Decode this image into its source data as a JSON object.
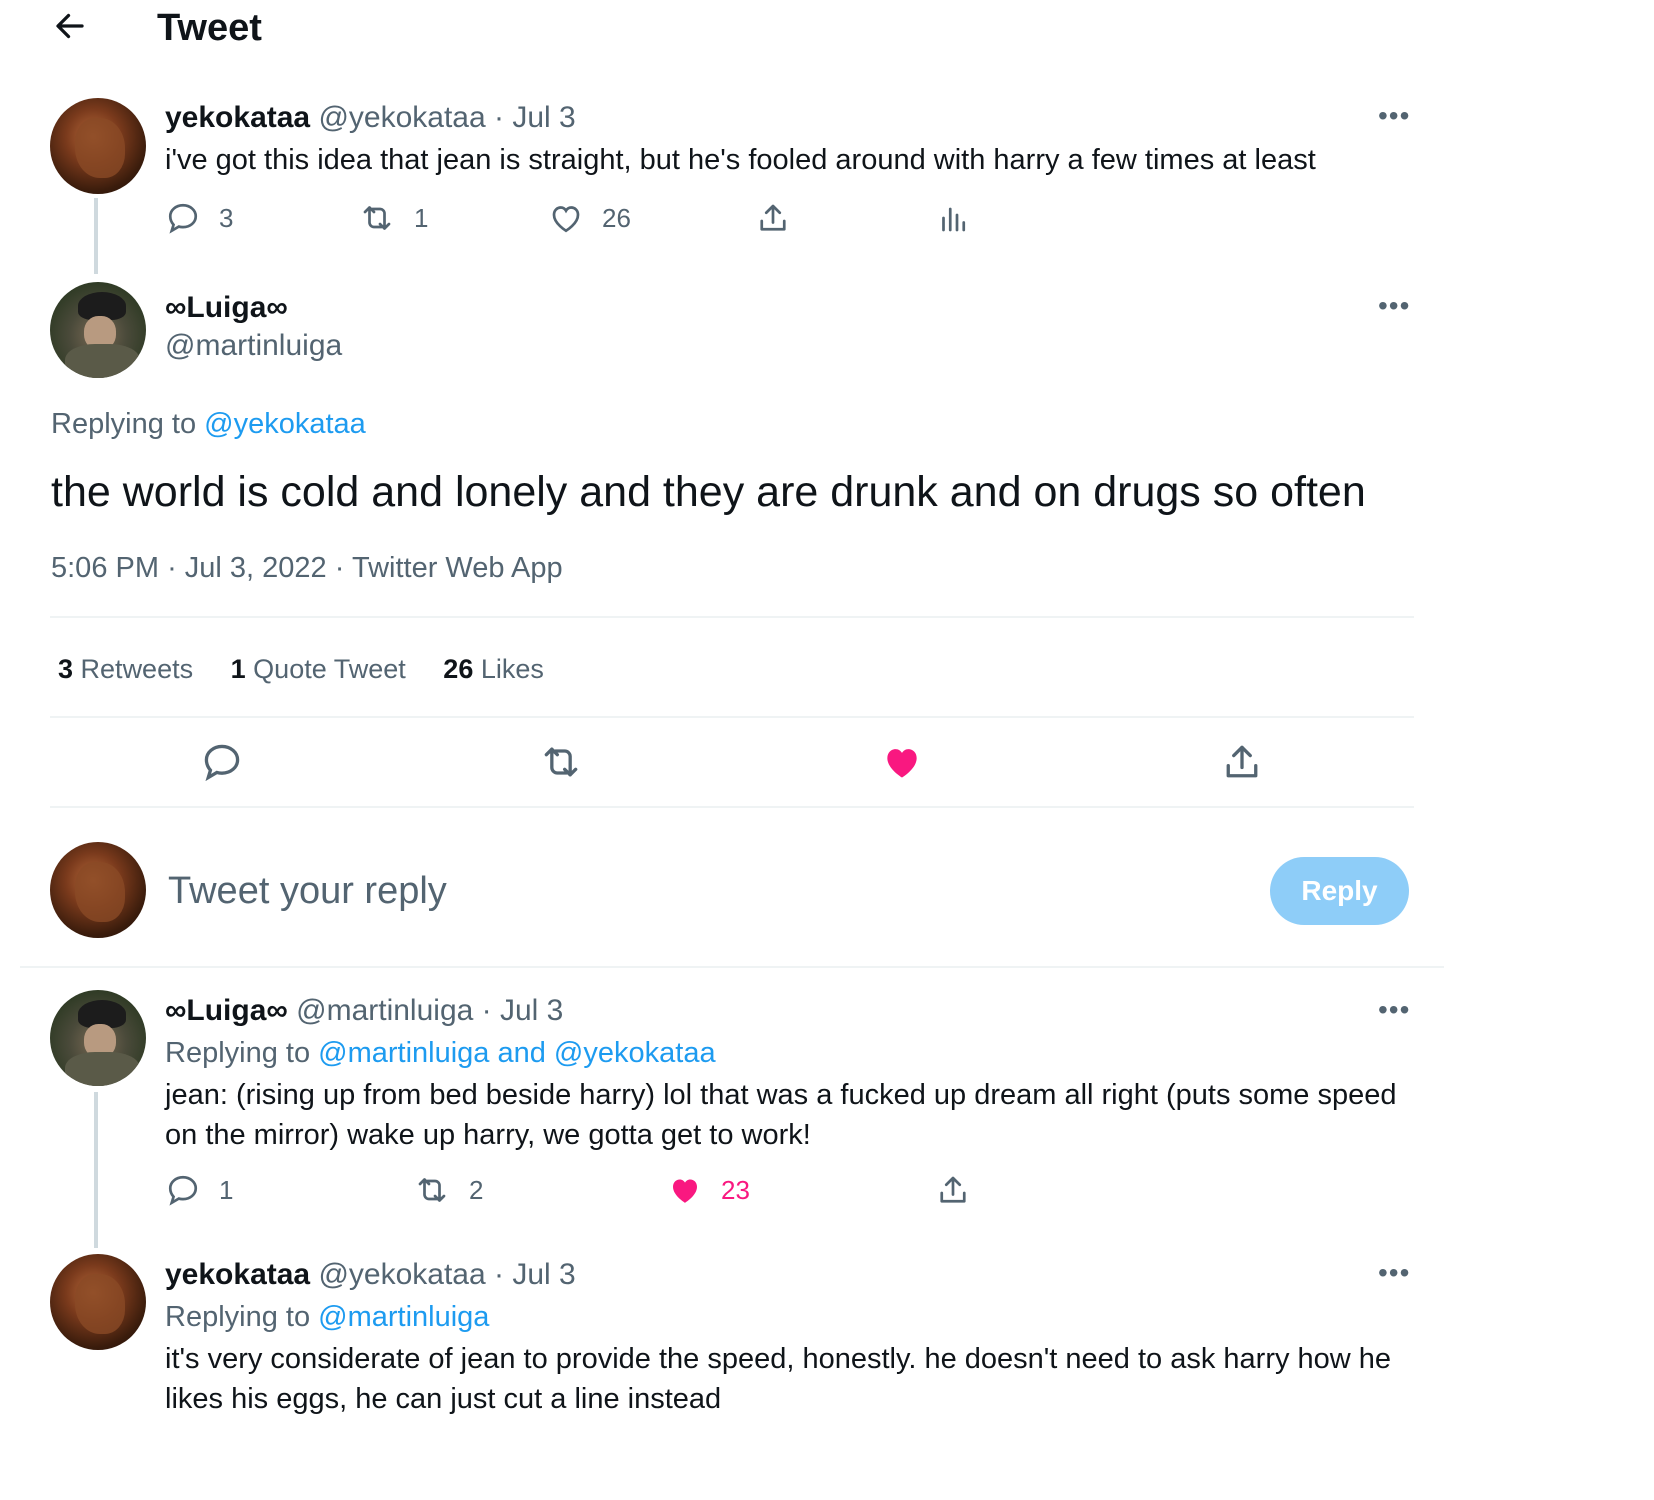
{
  "header": {
    "title": "Tweet"
  },
  "parent_tweet": {
    "display_name": "yekokataa",
    "handle": "@yekokataa",
    "date": "· Jul 3",
    "text": "i've got this idea that jean is straight, but he's fooled around with harry a few times at least",
    "replies": "3",
    "retweets": "1",
    "likes": "26"
  },
  "main_tweet": {
    "display_name": "∞Luiga∞",
    "handle": "@martinluiga",
    "replying_prefix": "Replying to",
    "replying_to": "@yekokataa",
    "text": "the world is cold and lonely and they are drunk and on drugs so often",
    "time": "5:06 PM",
    "date": "Jul 3, 2022",
    "source": "Twitter Web App",
    "sep": "·",
    "stats": {
      "retweets_count": "3",
      "retweets_label": "Retweets",
      "quotes_count": "1",
      "quotes_label": "Quote Tweet",
      "likes_count": "26",
      "likes_label": "Likes"
    }
  },
  "composer": {
    "placeholder": "Tweet your reply",
    "button": "Reply"
  },
  "replies": [
    {
      "display_name": "∞Luiga∞",
      "handle": "@martinluiga",
      "date": "· Jul 3",
      "replying_prefix": "Replying to",
      "replying_to": "@martinluiga and @yekokataa",
      "text": "jean: (rising up from bed beside harry) lol that was a fucked up dream all right (puts some speed on the mirror) wake up harry, we gotta get to work!",
      "replies": "1",
      "retweets": "2",
      "likes": "23"
    },
    {
      "display_name": "yekokataa",
      "handle": "@yekokataa",
      "date": "· Jul 3",
      "replying_prefix": "Replying to",
      "replying_to": "@martinluiga",
      "text": "it's very considerate of jean to provide the speed, honestly. he doesn't need to ask harry how he likes his eggs, he can just cut a line instead"
    }
  ],
  "colors": {
    "accent": "#1d9bf0",
    "like": "#f91880",
    "muted": "#536471",
    "reply_button_disabled": "#8ecdf8"
  },
  "icons": [
    "back-arrow-icon",
    "more-icon",
    "reply-icon",
    "retweet-icon",
    "like-icon",
    "share-icon",
    "analytics-icon"
  ]
}
